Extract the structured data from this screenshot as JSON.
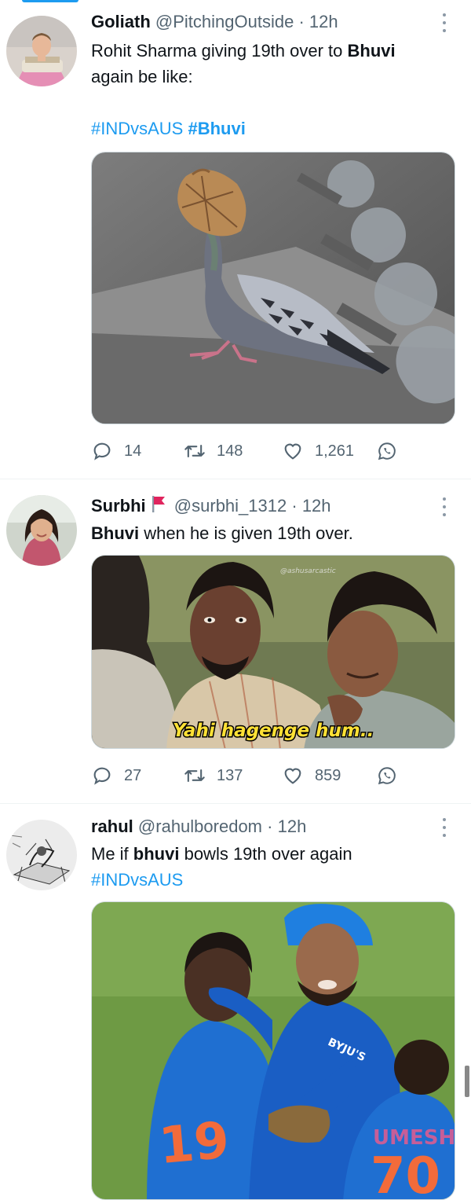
{
  "tweets": [
    {
      "name": "Goliath",
      "handle": "@PitchingOutside",
      "time": "12h",
      "text_parts": [
        "Rohit Sharma giving 19th over to ",
        "Bhuvi",
        "again be like:"
      ],
      "hashtags": [
        "#INDvsAUS",
        "#Bhuvi"
      ],
      "replies": "14",
      "retweets": "148",
      "likes": "1,261"
    },
    {
      "name": "Surbhi",
      "handle": "@surbhi_1312",
      "time": "12h",
      "text_parts": [
        "Bhuvi",
        " when he is given 19th over."
      ],
      "media_caption": "Yahi hagenge hum..",
      "media_watermark": "@ashusarcastic",
      "replies": "27",
      "retweets": "137",
      "likes": "859"
    },
    {
      "name": "rahul",
      "handle": "@rahulboredom",
      "time": "12h",
      "text_parts": [
        "Me if ",
        "bhuvi",
        " bowls 19th over again"
      ],
      "hashtags": [
        "#INDvsAUS"
      ],
      "media_texts": [
        "BYJU'S",
        "19",
        "UMESH",
        "70"
      ]
    }
  ],
  "separator": "·",
  "colors": {
    "accent": "#1d9bf0",
    "muted": "#536471",
    "flag": "#e0245e"
  }
}
